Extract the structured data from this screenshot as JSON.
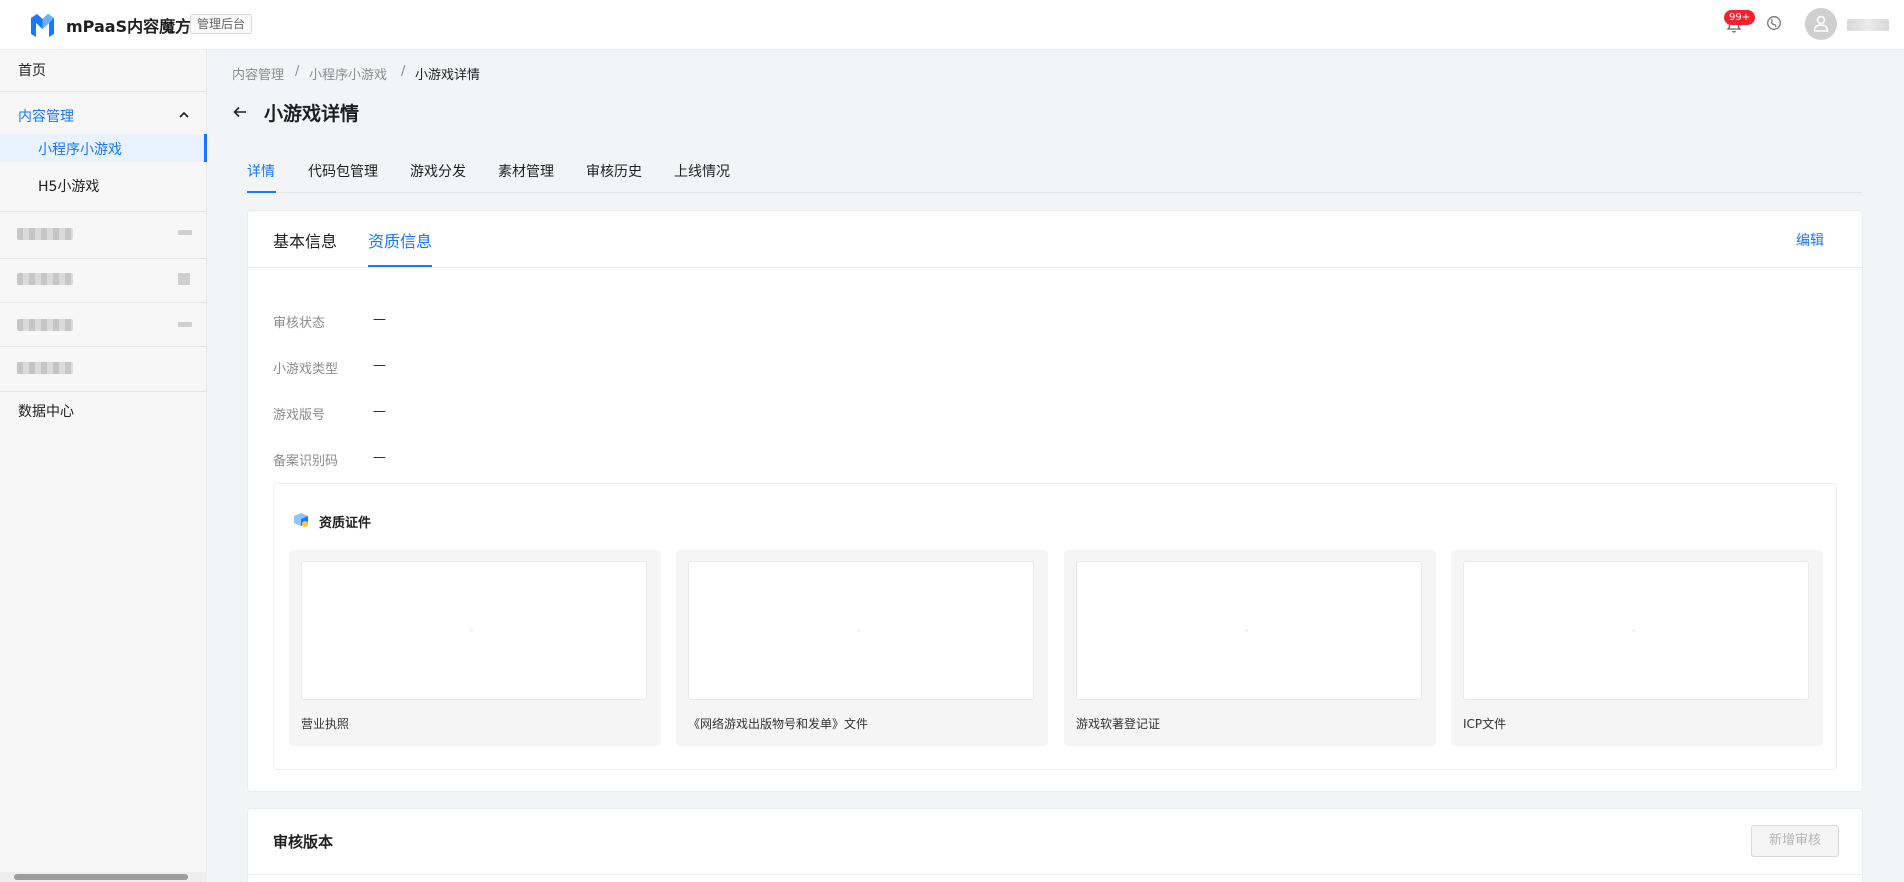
{
  "header": {
    "brand": "mPaaS内容魔方",
    "admin_tag": "管理后台",
    "notification_count": "99+",
    "icons": [
      "logo-icon",
      "bell-icon",
      "globe-icon",
      "user-icon"
    ]
  },
  "sidebar": {
    "home": "首页",
    "content_mgmt": "内容管理",
    "mini_game": "小程序小游戏",
    "h5_game": "H5小游戏",
    "data_center": "数据中心"
  },
  "breadcrumb": [
    "内容管理",
    "小程序小游戏",
    "小游戏详情"
  ],
  "page_title": "小游戏详情",
  "tabs": [
    "详情",
    "代码包管理",
    "游戏分发",
    "素材管理",
    "审核历史",
    "上线情况"
  ],
  "subtabs": [
    "基本信息",
    "资质信息"
  ],
  "edit_label": "编辑",
  "fields": [
    {
      "label": "审核状态",
      "value": "—"
    },
    {
      "label": "小游戏类型",
      "value": "—"
    },
    {
      "label": "游戏版号",
      "value": "—"
    },
    {
      "label": "备案识别码",
      "value": "—"
    }
  ],
  "certificates": {
    "title": "资质证件",
    "placeholder": "-",
    "items": [
      "营业执照",
      "《网络游戏出版物号和发单》文件",
      "游戏软著登记证",
      "ICP文件"
    ]
  },
  "review_section": {
    "title": "审核版本",
    "add_button": "新增审核"
  },
  "colors": {
    "accent": "#1677ff",
    "badge": "#f5222d"
  }
}
